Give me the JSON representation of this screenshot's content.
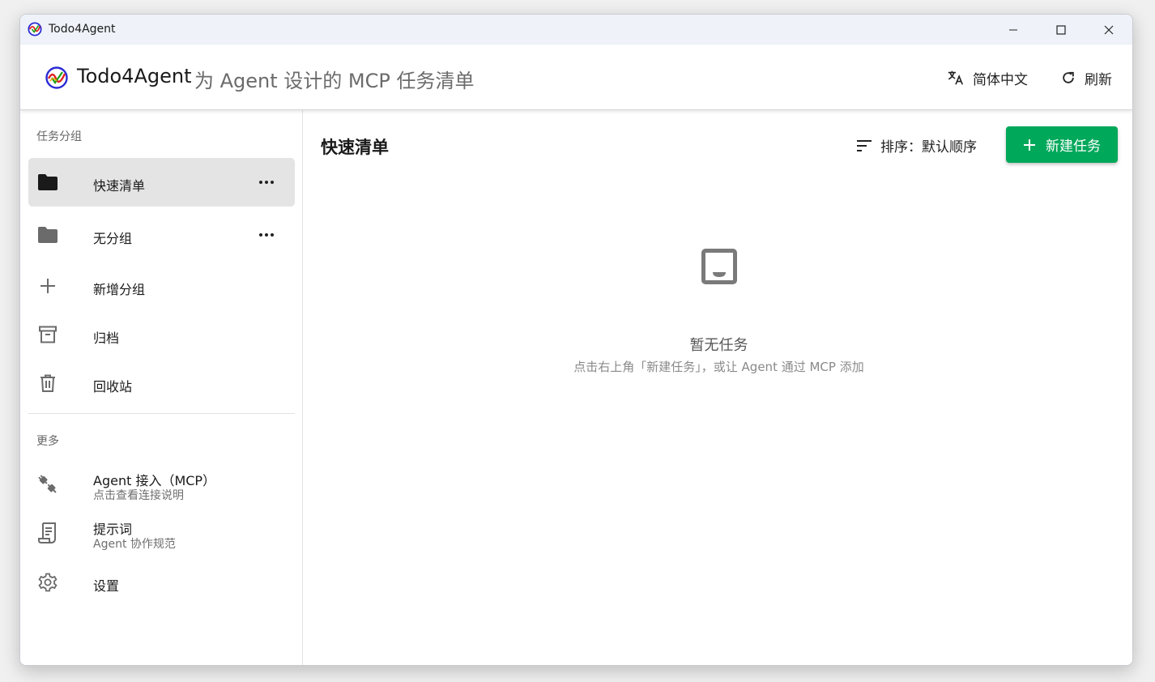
{
  "window": {
    "title": "Todo4Agent"
  },
  "header": {
    "brand": "Todo4Agent",
    "tagline": "为 Agent 设计的 MCP 任务清单",
    "language_label": "简体中文",
    "refresh_label": "刷新"
  },
  "sidebar": {
    "groups_label": "任务分组",
    "items": [
      {
        "label": "快速清单",
        "icon": "folder-icon",
        "active": true
      },
      {
        "label": "无分组",
        "icon": "folder-icon",
        "active": false
      },
      {
        "label": "新增分组",
        "icon": "plus-icon"
      },
      {
        "label": "归档",
        "icon": "archive-icon"
      },
      {
        "label": "回收站",
        "icon": "trash-icon"
      }
    ],
    "more_label": "更多",
    "more_items": [
      {
        "label": "Agent 接入（MCP）",
        "sub": "点击查看连接说明",
        "icon": "plug-icon"
      },
      {
        "label": "提示词",
        "sub": "Agent 协作规范",
        "icon": "scroll-icon"
      },
      {
        "label": "设置",
        "icon": "gear-icon"
      }
    ]
  },
  "main": {
    "heading": "快速清单",
    "sort_label": "排序：默认顺序",
    "new_task_label": "新建任务",
    "empty_title": "暂无任务",
    "empty_hint": "点击右上角「新建任务」，或让 Agent 通过 MCP 添加"
  },
  "colors": {
    "accent": "#00a85a",
    "titlebar": "#eff3f9",
    "active_item": "#e4e4e4"
  }
}
